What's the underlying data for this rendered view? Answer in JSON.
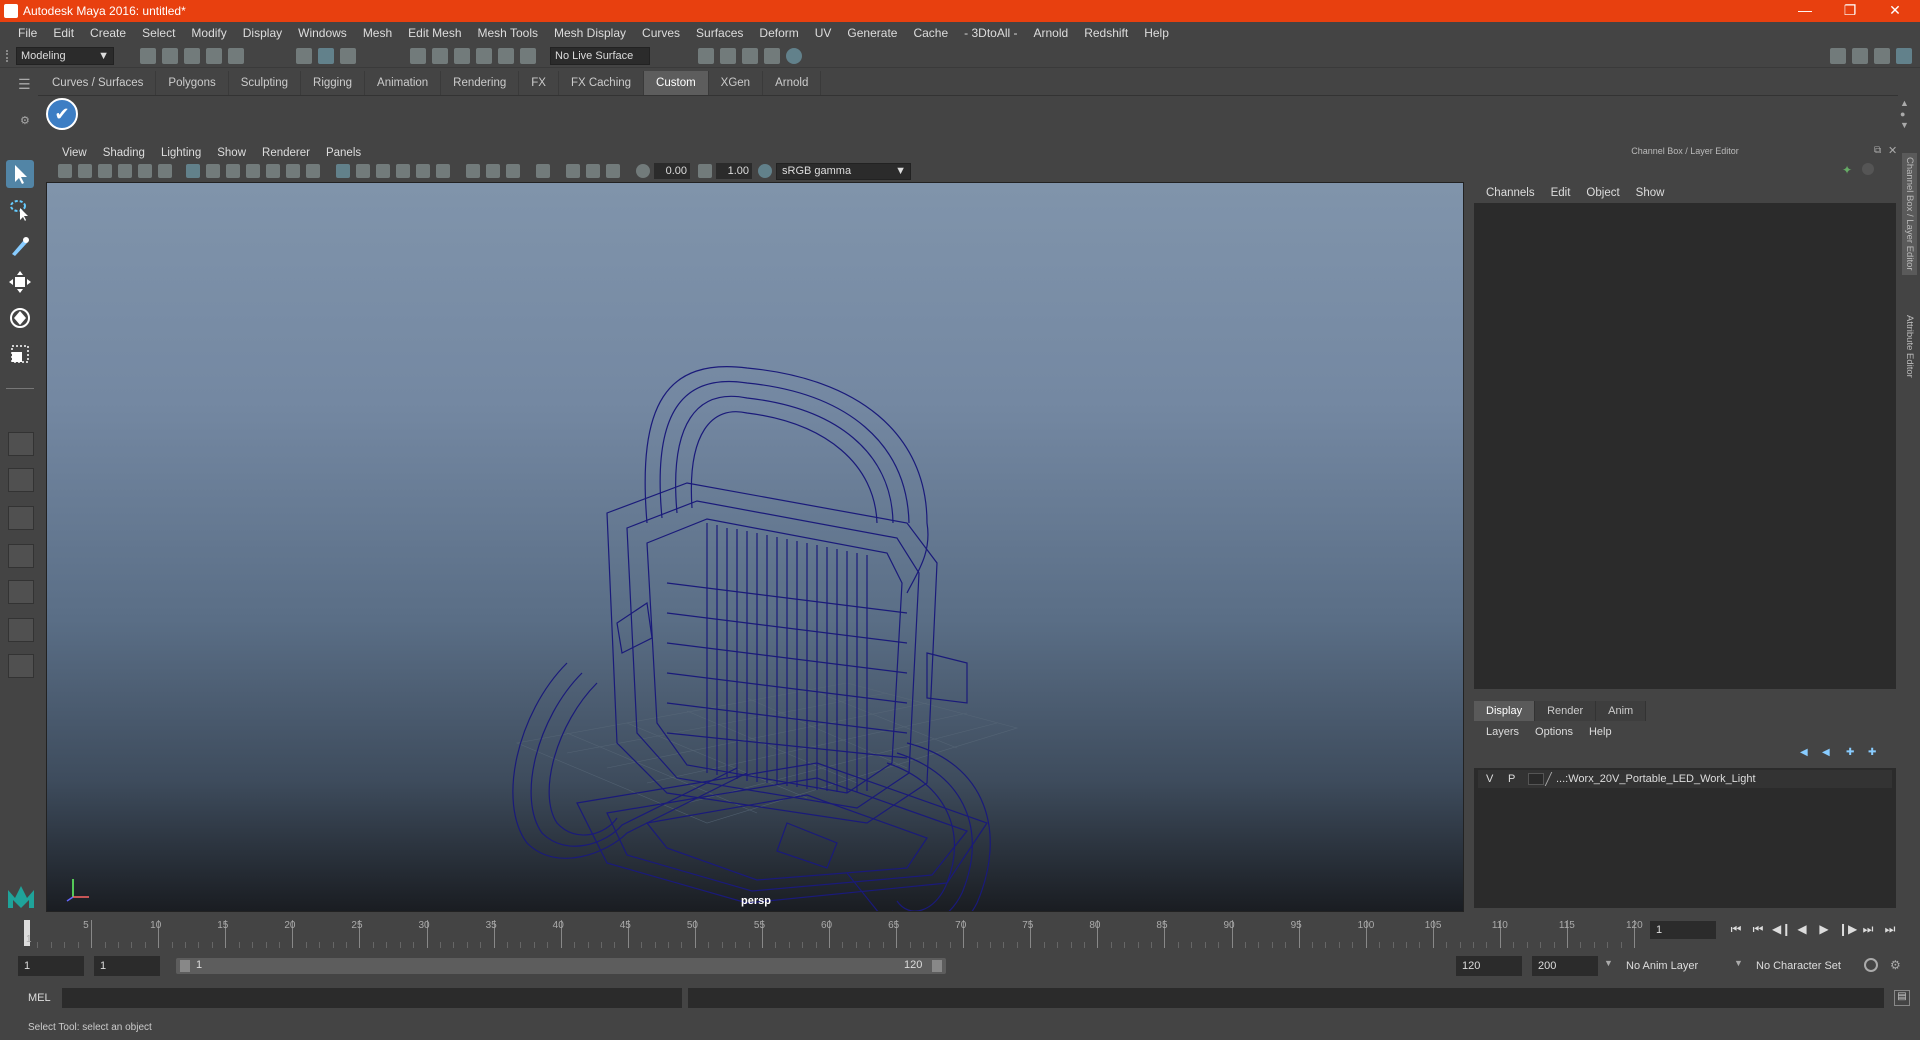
{
  "window": {
    "title": "Autodesk Maya 2016: untitled*"
  },
  "menubar": [
    "File",
    "Edit",
    "Create",
    "Select",
    "Modify",
    "Display",
    "Windows",
    "Mesh",
    "Edit Mesh",
    "Mesh Tools",
    "Mesh Display",
    "Curves",
    "Surfaces",
    "Deform",
    "UV",
    "Generate",
    "Cache",
    "- 3DtoAll -",
    "Arnold",
    "Redshift",
    "Help"
  ],
  "toolbar": {
    "mode": "Modeling",
    "live_surface": "No Live Surface"
  },
  "shelf_tabs": [
    "Curves / Surfaces",
    "Polygons",
    "Sculpting",
    "Rigging",
    "Animation",
    "Rendering",
    "FX",
    "FX Caching",
    "Custom",
    "XGen",
    "Arnold"
  ],
  "shelf_active": "Custom",
  "viewport": {
    "menu": [
      "View",
      "Shading",
      "Lighting",
      "Show",
      "Renderer",
      "Panels"
    ],
    "exposure": "0.00",
    "gamma_val": "1.00",
    "color_space": "sRGB gamma",
    "camera_label": "persp"
  },
  "channel_box": {
    "title": "Channel Box / Layer Editor",
    "menu": [
      "Channels",
      "Edit",
      "Object",
      "Show"
    ]
  },
  "layer_editor": {
    "tabs": [
      "Display",
      "Render",
      "Anim"
    ],
    "active_tab": "Display",
    "menu": [
      "Layers",
      "Options",
      "Help"
    ],
    "layer": {
      "v": "V",
      "p": "P",
      "name": "...:Worx_20V_Portable_LED_Work_Light"
    }
  },
  "side_tabs": [
    "Channel Box / Layer Editor",
    "Attribute Editor"
  ],
  "timeline": {
    "ticks": [
      5,
      10,
      15,
      20,
      25,
      30,
      35,
      40,
      45,
      50,
      55,
      60,
      65,
      70,
      75,
      80,
      85,
      90,
      95,
      100,
      105,
      110,
      115,
      120
    ],
    "start_label": "1",
    "current_frame": "1"
  },
  "range": {
    "start": "1",
    "playback_start": "1",
    "range_start": "1",
    "range_end": "120",
    "playback_end": "120",
    "end": "200",
    "anim_layer": "No Anim Layer",
    "character_set": "No Character Set"
  },
  "mel": {
    "label": "MEL"
  },
  "status": {
    "text": "Select Tool: select an object"
  }
}
